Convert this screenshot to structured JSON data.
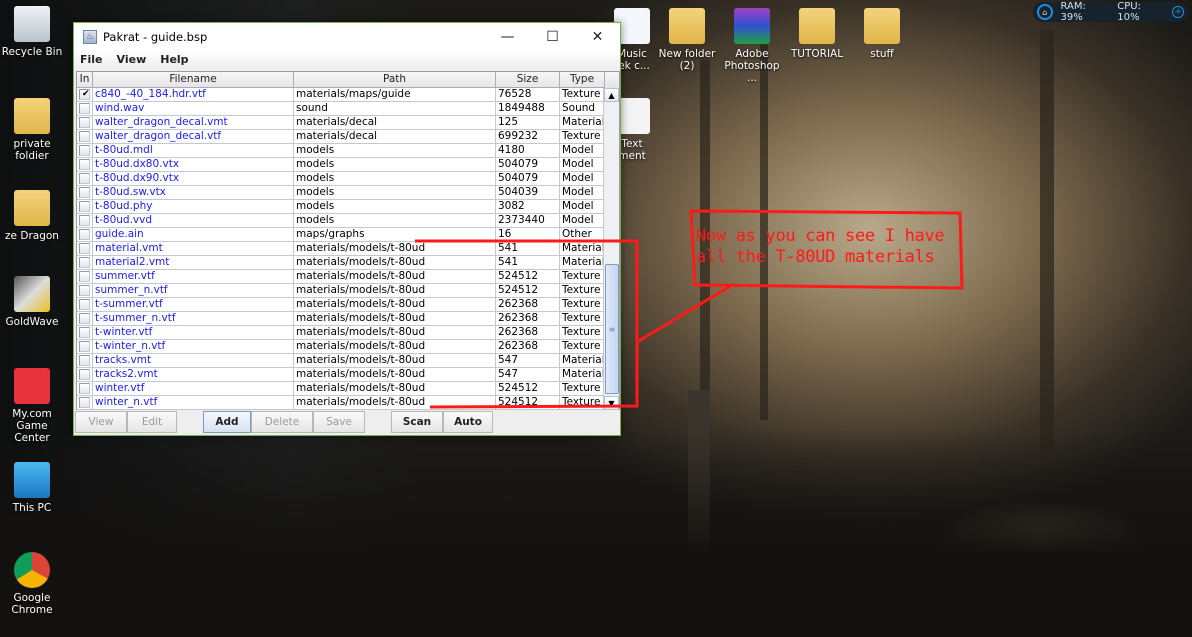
{
  "desktop": {
    "hud": {
      "ram": "RAM: 39%",
      "cpu": "CPU: 10%"
    },
    "icons_left": [
      {
        "label": "Recycle Bin",
        "icon": "recycle-bin-icon"
      },
      {
        "label": "private foldier",
        "icon": "folder-icon"
      },
      {
        "label": "ze Dragon",
        "icon": "folder-icon"
      },
      {
        "label": "GoldWave",
        "icon": "goldwave-icon"
      },
      {
        "label": "My.com Game Center",
        "icon": "gamepad-icon"
      },
      {
        "label": "This PC",
        "icon": "computer-icon"
      },
      {
        "label": "Google Chrome",
        "icon": "chrome-icon"
      }
    ],
    "icons_top": [
      {
        "label": "Music\nrek c...",
        "icon": "mp3-icon"
      },
      {
        "label": "New folder\n(2)",
        "icon": "folder-icon"
      },
      {
        "label": "Adobe\nPhotoshop ...",
        "icon": "winrar-icon"
      },
      {
        "label": "TUTORIAL",
        "icon": "folder-icon"
      },
      {
        "label": "stuff",
        "icon": "folder-icon"
      },
      {
        "label": "Text\nment",
        "icon": "text-document-icon"
      }
    ]
  },
  "window": {
    "title": "Pakrat - guide.bsp",
    "menu": [
      "File",
      "View",
      "Help"
    ],
    "columns": [
      "In",
      "Filename",
      "Path",
      "Size",
      "Type"
    ],
    "rows": [
      {
        "in": true,
        "filename": "c840_-40_184.hdr.vtf",
        "path": "materials/maps/guide",
        "size": "76528",
        "type": "Texture"
      },
      {
        "in": false,
        "filename": "wind.wav",
        "path": "sound",
        "size": "1849488",
        "type": "Sound"
      },
      {
        "in": false,
        "filename": "walter_dragon_decal.vmt",
        "path": "materials/decal",
        "size": "125",
        "type": "Material"
      },
      {
        "in": false,
        "filename": "walter_dragon_decal.vtf",
        "path": "materials/decal",
        "size": "699232",
        "type": "Texture"
      },
      {
        "in": false,
        "filename": "t-80ud.mdl",
        "path": "models",
        "size": "4180",
        "type": "Model"
      },
      {
        "in": false,
        "filename": "t-80ud.dx80.vtx",
        "path": "models",
        "size": "504079",
        "type": "Model"
      },
      {
        "in": false,
        "filename": "t-80ud.dx90.vtx",
        "path": "models",
        "size": "504079",
        "type": "Model"
      },
      {
        "in": false,
        "filename": "t-80ud.sw.vtx",
        "path": "models",
        "size": "504039",
        "type": "Model"
      },
      {
        "in": false,
        "filename": "t-80ud.phy",
        "path": "models",
        "size": "3082",
        "type": "Model"
      },
      {
        "in": false,
        "filename": "t-80ud.vvd",
        "path": "models",
        "size": "2373440",
        "type": "Model"
      },
      {
        "in": false,
        "filename": "guide.ain",
        "path": "maps/graphs",
        "size": "16",
        "type": "Other"
      },
      {
        "in": false,
        "filename": "material.vmt",
        "path": "materials/models/t-80ud",
        "size": "541",
        "type": "Material"
      },
      {
        "in": false,
        "filename": "material2.vmt",
        "path": "materials/models/t-80ud",
        "size": "541",
        "type": "Material"
      },
      {
        "in": false,
        "filename": "summer.vtf",
        "path": "materials/models/t-80ud",
        "size": "524512",
        "type": "Texture"
      },
      {
        "in": false,
        "filename": "summer_n.vtf",
        "path": "materials/models/t-80ud",
        "size": "524512",
        "type": "Texture"
      },
      {
        "in": false,
        "filename": "t-summer.vtf",
        "path": "materials/models/t-80ud",
        "size": "262368",
        "type": "Texture"
      },
      {
        "in": false,
        "filename": "t-summer_n.vtf",
        "path": "materials/models/t-80ud",
        "size": "262368",
        "type": "Texture"
      },
      {
        "in": false,
        "filename": "t-winter.vtf",
        "path": "materials/models/t-80ud",
        "size": "262368",
        "type": "Texture"
      },
      {
        "in": false,
        "filename": "t-winter_n.vtf",
        "path": "materials/models/t-80ud",
        "size": "262368",
        "type": "Texture"
      },
      {
        "in": false,
        "filename": "tracks.vmt",
        "path": "materials/models/t-80ud",
        "size": "547",
        "type": "Material"
      },
      {
        "in": false,
        "filename": "tracks2.vmt",
        "path": "materials/models/t-80ud",
        "size": "547",
        "type": "Material"
      },
      {
        "in": false,
        "filename": "winter.vtf",
        "path": "materials/models/t-80ud",
        "size": "524512",
        "type": "Texture"
      },
      {
        "in": false,
        "filename": "winter_n.vtf",
        "path": "materials/models/t-80ud",
        "size": "524512",
        "type": "Texture"
      }
    ],
    "buttons": [
      {
        "label": "View",
        "enabled": false
      },
      {
        "label": "Edit",
        "enabled": false
      },
      {
        "label": "Add",
        "enabled": true
      },
      {
        "label": "Delete",
        "enabled": false
      },
      {
        "label": "Save",
        "enabled": false
      },
      {
        "label": "Scan",
        "enabled": true
      },
      {
        "label": "Auto",
        "enabled": true
      }
    ]
  },
  "annotation": {
    "line1": "Now as you can see I have",
    "line2": "all the T-80UD materials",
    "color": "#ff1a1a"
  }
}
